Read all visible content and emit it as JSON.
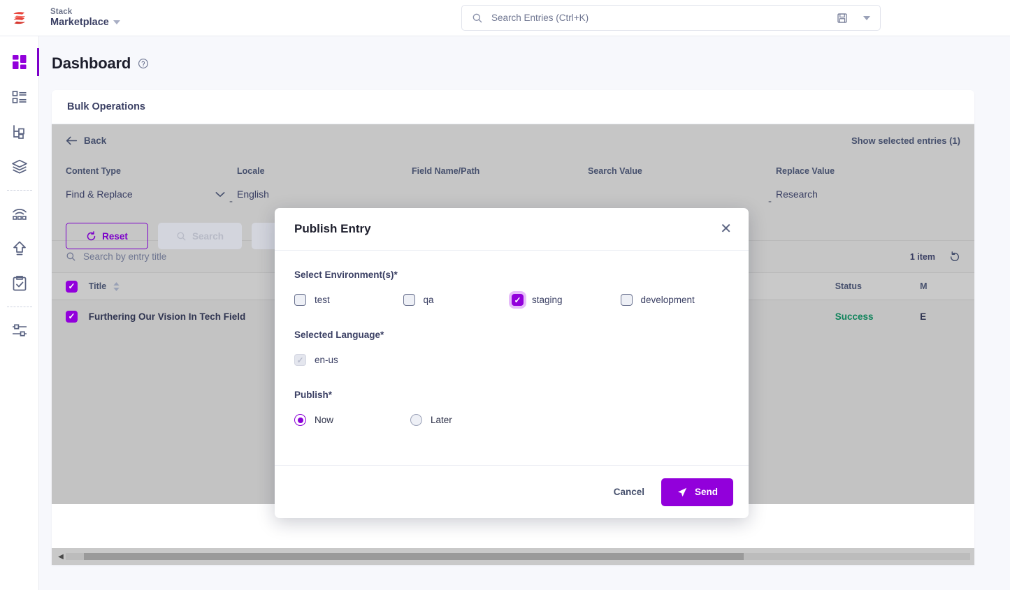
{
  "topbar": {
    "logo_icon": "contentstack-logo-icon",
    "stack_label": "Stack",
    "stack_name": "Marketplace",
    "search": {
      "placeholder": "Search Entries (Ctrl+K)",
      "search_icon": "search-icon",
      "save_icon": "floppy-disk-icon",
      "chevron_icon": "chevron-down-icon"
    }
  },
  "sidebar": {
    "items": [
      {
        "name": "dashboard",
        "icon": "dashboard-grid-icon",
        "active": true
      },
      {
        "name": "content-types",
        "icon": "content-list-icon",
        "active": false
      },
      {
        "name": "taxonomy",
        "icon": "hierarchy-tree-icon",
        "active": false
      },
      {
        "name": "assets",
        "icon": "layers-stack-icon",
        "active": false
      },
      {
        "name": "releases",
        "icon": "broadcast-icon",
        "active": false
      },
      {
        "name": "publish-queue",
        "icon": "upload-arrow-icon",
        "active": false
      },
      {
        "name": "audit-log",
        "icon": "clipboard-check-icon",
        "active": false
      },
      {
        "name": "settings",
        "icon": "sliders-icon",
        "active": false
      }
    ]
  },
  "page": {
    "title": "Dashboard",
    "help_icon": "help-circle-icon"
  },
  "card": {
    "header_title": "Bulk Operations",
    "toolbar": {
      "back_label": "Back",
      "back_icon": "arrow-left-icon",
      "show_selected_label": "Show selected entries (1)"
    },
    "filters": [
      {
        "label": "Content Type",
        "value": "Find & Replace",
        "has_chevron": true
      },
      {
        "label": "Locale",
        "value": "English",
        "has_chevron": false
      },
      {
        "label": "Field Name/Path",
        "value": "",
        "has_chevron": false
      },
      {
        "label": "Search Value",
        "value": "",
        "has_chevron": false
      },
      {
        "label": "Replace Value",
        "value": "Research",
        "has_chevron": false
      }
    ],
    "buttons": {
      "reset_label": "Reset",
      "reset_icon": "refresh-icon",
      "search_label": "Search",
      "search_icon": "search-icon",
      "third_label": ""
    },
    "entry_search": {
      "placeholder": "Search by entry title",
      "search_icon": "search-icon",
      "item_count": "1 item",
      "refresh_icon": "refresh-ccw-icon"
    },
    "table": {
      "columns": [
        "Title",
        "Status",
        "M"
      ],
      "sort_icon": "sort-arrows-icon",
      "header_checked": true,
      "rows": [
        {
          "checked": true,
          "title": "Furthering Our Vision In Tech Field",
          "title_overflow": "g Our Vision",
          "status": "Success",
          "more": "E"
        }
      ]
    },
    "scrollbar": {
      "left_arrow": "◀",
      "right_arrow": "▶"
    }
  },
  "modal": {
    "title": "Publish Entry",
    "close_icon": "close-icon",
    "environment_section_label": "Select Environment(s)*",
    "environments": [
      {
        "label": "test",
        "checked": false,
        "focused": false
      },
      {
        "label": "qa",
        "checked": false,
        "focused": false
      },
      {
        "label": "staging",
        "checked": true,
        "focused": true
      },
      {
        "label": "development",
        "checked": false,
        "focused": false
      }
    ],
    "language_section_label": "Selected Language*",
    "languages": [
      {
        "label": "en-us",
        "checked": true,
        "disabled": true
      }
    ],
    "publish_section_label": "Publish*",
    "publish_options": [
      {
        "label": "Now",
        "selected": true
      },
      {
        "label": "Later",
        "selected": false
      }
    ],
    "footer": {
      "cancel_label": "Cancel",
      "send_label": "Send",
      "send_icon": "paper-plane-icon"
    }
  },
  "colors": {
    "brand_purple": "#9200DB",
    "accent_purple": "#7C00C9",
    "success_green": "#11845C",
    "text_dark": "#3B4064",
    "page_bg": "#F7F8FC",
    "overlay_grey": "#C6C6C6",
    "logo_red": "#EE4B4B"
  }
}
